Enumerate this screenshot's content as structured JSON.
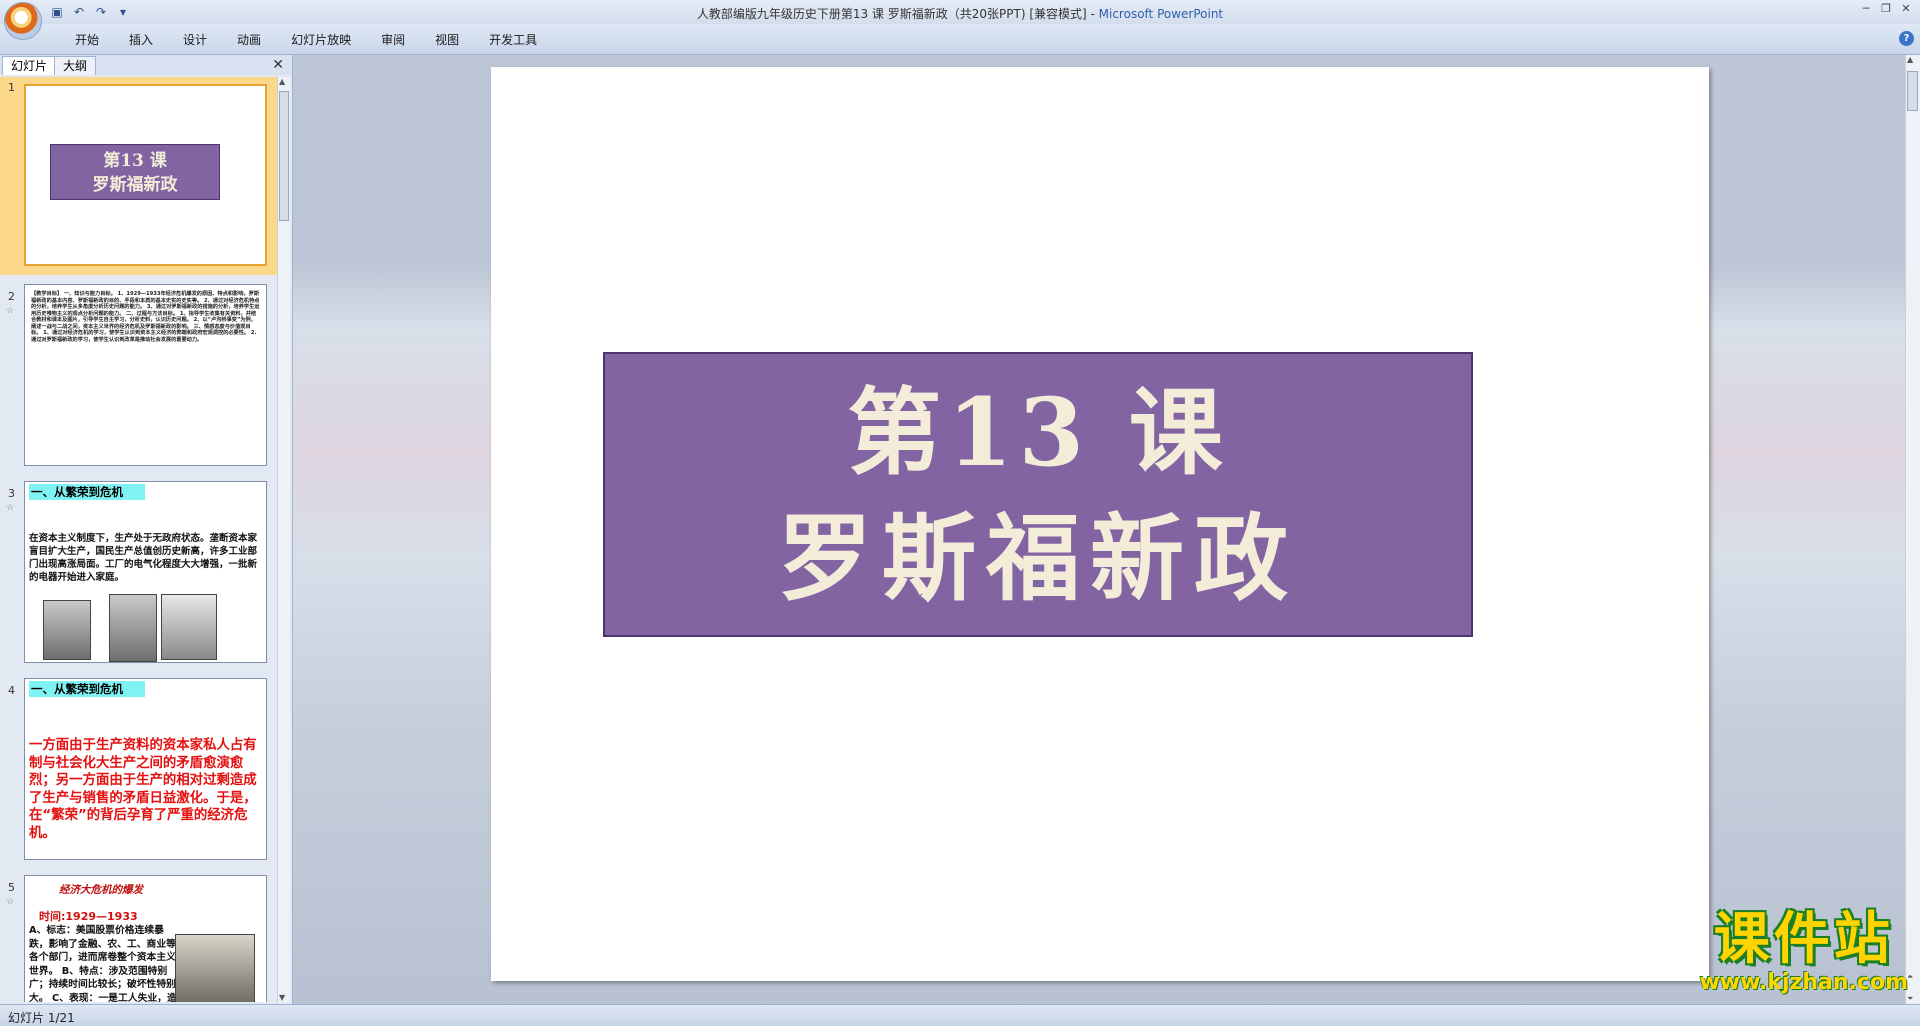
{
  "window": {
    "title": "人教部编版九年级历史下册第13 课  罗斯福新政（共20张PPT) [兼容模式] - ",
    "app_name": "Microsoft PowerPoint"
  },
  "ribbon": {
    "tabs": [
      "开始",
      "插入",
      "设计",
      "动画",
      "幻灯片放映",
      "审阅",
      "视图",
      "开发工具"
    ]
  },
  "panel": {
    "tabs": [
      "幻灯片",
      "大纲"
    ]
  },
  "thumbnails": [
    {
      "num": "1",
      "line1": "第13  课",
      "line2": "罗斯福新政"
    },
    {
      "num": "2",
      "text": "【教学目标】 一、知识与能力目标。 1、1929—1933年经济危机爆发的原因、特点和影响，罗斯福新政的基本内容、罗斯福新政的目的、手段和本质的基本史实的史实等。 2、通过对经济危机特点的分析，培养学生从多角度分析历史问题的能力。 3、通过对罗斯福新政的措施的分析，培养学生运用历史唯物主义的观点分析问题的能力。 二、过程与方法目标。 1、指导学生收集有关资料，并结合教材和课本及图片，引导学生自主学习，分析史料，认识历史问题。 2、以“卢沟桥事变”为例，阐述一战与二战之间，资本主义世界的经济危机及罗斯福新政的影响。 三、情感态度与价值观目标。 1、通过对经济危机的学习，使学生认识到资本主义经济的弊端和政府宏观调控的必要性。 2、通过对罗斯福新政的学习，使学生认识到改革是推动社会发展的重要动力。"
    },
    {
      "num": "3",
      "heading": "一、从繁荣到危机",
      "text": "在资本主义制度下，生产处于无政府状态。垄断资本家盲目扩大生产，国民生产总值创历史新高，许多工业部门出现高涨局面。工厂的电气化程度大大增强，一批新的电器开始进入家庭。"
    },
    {
      "num": "4",
      "heading": "一、从繁荣到危机",
      "text": "一方面由于生产资料的资本家私人占有制与社会化大生产之间的矛盾愈演愈烈；另一方面由于生产的相对过剩造成了生产与销售的矛盾日益激化。于是，在“繁荣”的背后孕育了严重的经济危机。"
    },
    {
      "num": "5",
      "title": "经济大危机的爆发",
      "time": "时间:1929—1933",
      "text": "A、标志：美国股票价格连续暴跌，影响了金融、农、工、商业等各个部门，进而席卷整个资本主义世界。 B、特点：涉及范围特别广；持续时间比较长；破坏性特别大。 C、表现：一是工人失业，造成"
    }
  ],
  "slide": {
    "line1": "第13  课",
    "line2": "罗斯福新政"
  },
  "watermark": {
    "name": "课件站",
    "url": "www.kjzhan.com"
  },
  "status": {
    "slide_indicator": "幻灯片 1/21"
  }
}
